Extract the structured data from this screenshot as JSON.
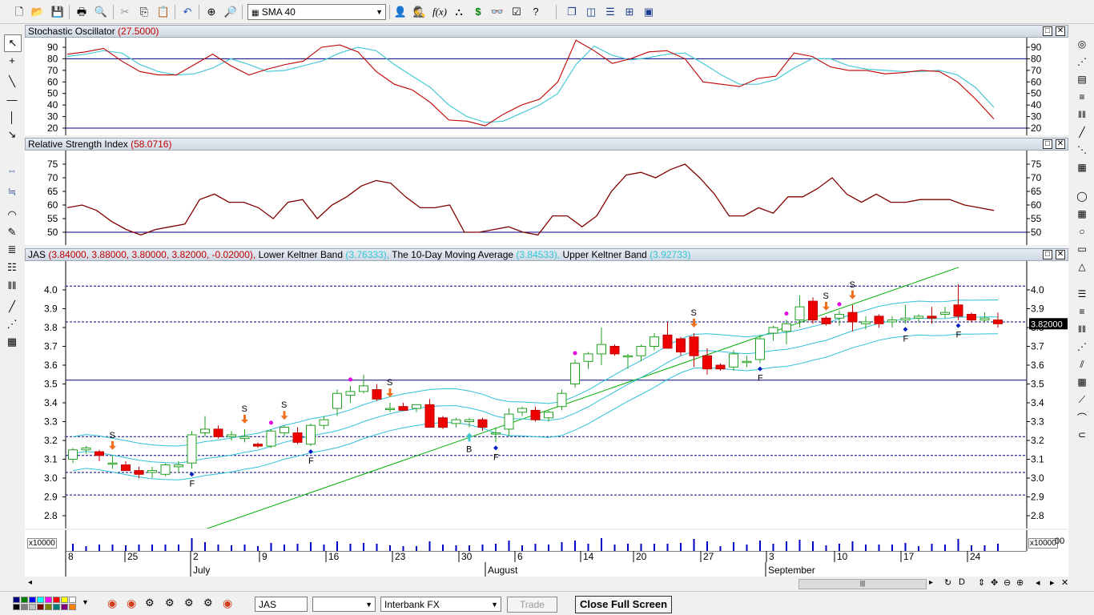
{
  "toolbar": {
    "indicator_select": "SMA 40",
    "icons": [
      "new-file-icon",
      "open-folder-icon",
      "save-icon",
      "print-icon",
      "print-preview-icon",
      "cut-icon",
      "copy-icon",
      "paste-icon",
      "undo-icon",
      "crosshair-icon",
      "zoom-icon",
      "indicator-list-icon",
      "hide-icon",
      "trader-icon",
      "function-icon",
      "hierarchy-icon",
      "dollar-icon",
      "binoculars-icon",
      "properties-icon",
      "help-icon",
      "cascade-windows-icon",
      "tile-vertical-icon",
      "tile-horizontal-icon",
      "grid-windows-icon",
      "screen-icon"
    ]
  },
  "stochastic": {
    "label": "Stochastic Oscillator",
    "value": "(27.5000)",
    "ticks": [
      "90",
      "80",
      "70",
      "60",
      "50",
      "40",
      "30",
      "20"
    ],
    "range": [
      20,
      100
    ],
    "reference": 80,
    "k_line": [
      84,
      86,
      89,
      78,
      69,
      66,
      66,
      75,
      84,
      74,
      66,
      71,
      75,
      78,
      90,
      92,
      86,
      69,
      58,
      53,
      42,
      27,
      26,
      22,
      32,
      40,
      45,
      60,
      96,
      87,
      76,
      80,
      86,
      87,
      80,
      60,
      58,
      56,
      63,
      65,
      85,
      82,
      73,
      70,
      70,
      67,
      68,
      70,
      69,
      60,
      45,
      28
    ],
    "d_line": [
      82,
      84,
      87,
      85,
      75,
      69,
      66,
      67,
      72,
      80,
      75,
      69,
      70,
      74,
      78,
      85,
      90,
      87,
      75,
      65,
      55,
      40,
      30,
      25,
      26,
      33,
      40,
      50,
      75,
      91,
      83,
      79,
      81,
      84,
      85,
      76,
      66,
      58,
      58,
      62,
      72,
      80,
      80,
      74,
      71,
      70,
      69,
      69,
      70,
      66,
      55,
      38
    ]
  },
  "rsi": {
    "label": "Relative Strength Index",
    "value": "(58.0716)",
    "ticks": [
      "75",
      "70",
      "65",
      "60",
      "55",
      "50"
    ],
    "range": [
      46,
      79
    ],
    "reference": 50,
    "line": [
      59,
      60,
      58,
      54,
      51,
      49,
      51,
      52,
      53,
      62,
      64,
      61,
      61,
      59,
      55,
      61,
      62,
      55,
      60,
      63,
      67,
      69,
      68,
      63,
      59,
      59,
      60,
      50,
      50,
      51,
      52,
      50,
      49,
      56,
      56,
      52,
      56,
      65,
      71,
      72,
      70,
      73,
      75,
      70,
      64,
      56,
      56,
      59,
      57,
      63,
      63,
      66,
      70,
      64,
      61,
      64,
      61,
      61,
      62,
      62,
      62,
      60,
      59,
      58
    ]
  },
  "price": {
    "title_symbol": "JAS",
    "title_values": "(3.84000, 3.88000, 3.80000, 3.82000, -0.02000),",
    "lower_label": "Lower Keltner Band",
    "lower_value": "(3.76333),",
    "ma_label": "The 10-Day Moving Average",
    "ma_value": "(3.84533),",
    "upper_label": "Upper Keltner Band",
    "upper_value": "(3.92733)",
    "ticks": [
      "4.0",
      "3.9",
      "3.8",
      "3.7",
      "3.6",
      "3.5",
      "3.4",
      "3.3",
      "3.2",
      "3.1",
      "3.0",
      "2.9",
      "2.8"
    ],
    "range": [
      2.73,
      4.14
    ],
    "current_price": "3.82000",
    "hlines": [
      4.02,
      3.83,
      3.52,
      3.22,
      3.12,
      3.03,
      2.91
    ],
    "trendline": [
      2.47,
      4.12
    ],
    "candles": [
      [
        3.1,
        3.16,
        3.08,
        3.15
      ],
      [
        3.15,
        3.17,
        3.13,
        3.16
      ],
      [
        3.14,
        3.15,
        3.09,
        3.12
      ],
      [
        3.08,
        3.12,
        3.05,
        3.08
      ],
      [
        3.07,
        3.09,
        3.04,
        3.04
      ],
      [
        3.04,
        3.06,
        3.0,
        3.02
      ],
      [
        3.03,
        3.06,
        3.0,
        3.04
      ],
      [
        3.02,
        3.08,
        3.01,
        3.07
      ],
      [
        3.06,
        3.09,
        3.03,
        3.07
      ],
      [
        3.08,
        3.25,
        3.05,
        3.23
      ],
      [
        3.24,
        3.33,
        3.22,
        3.26
      ],
      [
        3.26,
        3.28,
        3.21,
        3.22
      ],
      [
        3.22,
        3.25,
        3.2,
        3.23
      ],
      [
        3.21,
        3.26,
        3.19,
        3.22
      ],
      [
        3.18,
        3.19,
        3.16,
        3.17
      ],
      [
        3.17,
        3.26,
        3.16,
        3.25
      ],
      [
        3.24,
        3.28,
        3.22,
        3.27
      ],
      [
        3.24,
        3.27,
        3.18,
        3.19
      ],
      [
        3.18,
        3.29,
        3.17,
        3.28
      ],
      [
        3.28,
        3.33,
        3.26,
        3.31
      ],
      [
        3.37,
        3.47,
        3.33,
        3.45
      ],
      [
        3.44,
        3.49,
        3.4,
        3.46
      ],
      [
        3.46,
        3.55,
        3.45,
        3.49
      ],
      [
        3.47,
        3.5,
        3.41,
        3.42
      ],
      [
        3.37,
        3.4,
        3.35,
        3.37
      ],
      [
        3.38,
        3.4,
        3.36,
        3.36
      ],
      [
        3.37,
        3.39,
        3.35,
        3.39
      ],
      [
        3.39,
        3.42,
        3.29,
        3.27
      ],
      [
        3.32,
        3.33,
        3.26,
        3.27
      ],
      [
        3.29,
        3.32,
        3.27,
        3.31
      ],
      [
        3.3,
        3.32,
        3.27,
        3.31
      ],
      [
        3.31,
        3.32,
        3.25,
        3.27
      ],
      [
        3.24,
        3.27,
        3.19,
        3.24
      ],
      [
        3.26,
        3.37,
        3.22,
        3.34
      ],
      [
        3.35,
        3.38,
        3.33,
        3.37
      ],
      [
        3.36,
        3.38,
        3.3,
        3.31
      ],
      [
        3.32,
        3.36,
        3.3,
        3.35
      ],
      [
        3.38,
        3.47,
        3.36,
        3.45
      ],
      [
        3.5,
        3.63,
        3.48,
        3.61
      ],
      [
        3.62,
        3.67,
        3.58,
        3.66
      ],
      [
        3.66,
        3.8,
        3.6,
        3.71
      ],
      [
        3.7,
        3.71,
        3.65,
        3.66
      ],
      [
        3.65,
        3.66,
        3.58,
        3.65
      ],
      [
        3.65,
        3.71,
        3.62,
        3.7
      ],
      [
        3.7,
        3.77,
        3.68,
        3.75
      ],
      [
        3.76,
        3.83,
        3.74,
        3.69
      ],
      [
        3.74,
        3.75,
        3.65,
        3.67
      ],
      [
        3.75,
        3.77,
        3.59,
        3.65
      ],
      [
        3.65,
        3.69,
        3.55,
        3.58
      ],
      [
        3.6,
        3.61,
        3.57,
        3.58
      ],
      [
        3.59,
        3.68,
        3.57,
        3.66
      ],
      [
        3.62,
        3.65,
        3.59,
        3.62
      ],
      [
        3.63,
        3.76,
        3.61,
        3.74
      ],
      [
        3.77,
        3.81,
        3.73,
        3.8
      ],
      [
        3.78,
        3.84,
        3.71,
        3.82
      ],
      [
        3.84,
        3.97,
        3.8,
        3.91
      ],
      [
        3.94,
        3.96,
        3.82,
        3.84
      ],
      [
        3.85,
        3.86,
        3.81,
        3.82
      ],
      [
        3.85,
        3.89,
        3.81,
        3.87
      ],
      [
        3.88,
        3.92,
        3.78,
        3.83
      ],
      [
        3.82,
        3.86,
        3.79,
        3.83
      ],
      [
        3.86,
        3.87,
        3.8,
        3.82
      ],
      [
        3.83,
        3.86,
        3.8,
        3.84
      ],
      [
        3.84,
        3.92,
        3.82,
        3.85
      ],
      [
        3.85,
        3.87,
        3.83,
        3.86
      ],
      [
        3.86,
        3.91,
        3.82,
        3.85
      ],
      [
        3.87,
        3.91,
        3.85,
        3.88
      ],
      [
        3.92,
        4.03,
        3.84,
        3.86
      ],
      [
        3.87,
        3.88,
        3.83,
        3.84
      ],
      [
        3.84,
        3.88,
        3.83,
        3.85
      ],
      [
        3.84,
        3.88,
        3.8,
        3.82
      ]
    ],
    "signals": [
      {
        "i": 3,
        "type": "S",
        "dir": "down"
      },
      {
        "i": 13,
        "type": "S",
        "dir": "down"
      },
      {
        "i": 16,
        "type": "S",
        "dir": "down"
      },
      {
        "i": 24,
        "type": "S",
        "dir": "down"
      },
      {
        "i": 47,
        "type": "S",
        "dir": "down"
      },
      {
        "i": 57,
        "type": "S",
        "dir": "down"
      },
      {
        "i": 59,
        "type": "S",
        "dir": "down"
      },
      {
        "i": 30,
        "type": "B",
        "dir": "up"
      },
      {
        "i": 9,
        "type": "F"
      },
      {
        "i": 18,
        "type": "F"
      },
      {
        "i": 32,
        "type": "F"
      },
      {
        "i": 52,
        "type": "F"
      },
      {
        "i": 63,
        "type": "F"
      },
      {
        "i": 67,
        "type": "F"
      }
    ],
    "dots": [
      15,
      21,
      38,
      54,
      58
    ]
  },
  "volume": {
    "scale_left": "x10000",
    "scale_right": "x10000",
    "tail": "00"
  },
  "xaxis": {
    "day_labels": [
      "8",
      "25",
      "2",
      "9",
      "16",
      "23",
      "30",
      "6",
      "14",
      "20",
      "27",
      "3",
      "10",
      "17",
      "24"
    ],
    "month_labels": [
      "July",
      "August",
      "September"
    ]
  },
  "statusbar": {
    "symbol": "JAS",
    "exchange": "Interbank FX",
    "trade_label": "Trade",
    "close_fullscreen_label": "Close Full Screen",
    "colors": [
      "#000080",
      "#008000",
      "#0000ff",
      "#00ffff",
      "#ff00ff",
      "#ff0000",
      "#ffff00",
      "#ffffff",
      "#000000",
      "#808080",
      "#c0c0c0",
      "#800000",
      "#808000",
      "#008080",
      "#800080",
      "#ff8000"
    ]
  }
}
